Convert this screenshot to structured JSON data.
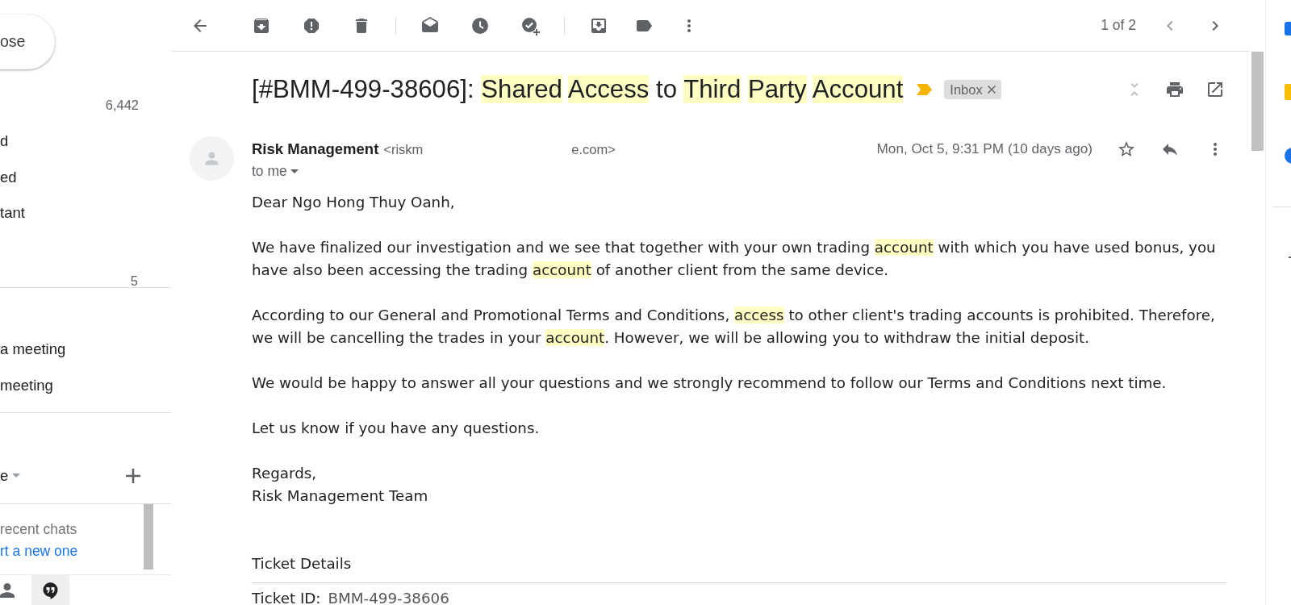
{
  "sidebar": {
    "compose_button": "ose",
    "inbox_count": "6,442",
    "folders": [
      {
        "label": "d"
      },
      {
        "label": "ed"
      },
      {
        "label": "tant"
      }
    ],
    "more_count": "5",
    "meet_items": [
      {
        "label": "a meeting"
      },
      {
        "label": "meeting"
      }
    ],
    "hangouts": {
      "status_label": "e",
      "empty_text": "recent chats",
      "start_link": "rt a new one"
    },
    "bottom_tabs": [
      {
        "kind": "contacts",
        "selected": false
      },
      {
        "kind": "chat",
        "selected": true
      }
    ]
  },
  "toolbar": {
    "pagination": "1 of 2"
  },
  "message": {
    "subject_words": [
      {
        "text": "[#BMM-499-38606]:",
        "highlight": false
      },
      {
        "text": "Shared",
        "highlight": true
      },
      {
        "text": "Access",
        "highlight": true
      },
      {
        "text": "to",
        "highlight": false
      },
      {
        "text": "Third",
        "highlight": true
      },
      {
        "text": "Party",
        "highlight": true
      },
      {
        "text": "Account",
        "highlight": true
      }
    ],
    "important": true,
    "labels": [
      {
        "text": "Inbox"
      }
    ],
    "sender_name": "Risk Management",
    "sender_email_start": "<riskm",
    "sender_email_end": "e.com>",
    "recipient": "to me",
    "date": "Mon, Oct 5, 9:31 PM (10 days ago)",
    "starred": false,
    "body": [
      {
        "kind": "paragraph",
        "segments": [
          {
            "text": "Dear Ngo Hong Thuy Oanh,",
            "highlight": false
          }
        ]
      },
      {
        "kind": "paragraph",
        "segments": [
          {
            "text": "We have finalized our investigation and we see that together with your own trading ",
            "highlight": false
          },
          {
            "text": "account",
            "highlight": true
          },
          {
            "text": " with which you have used bonus, you have also been accessing the trading ",
            "highlight": false
          },
          {
            "text": "account",
            "highlight": true
          },
          {
            "text": " of another client from the same device.",
            "highlight": false
          }
        ]
      },
      {
        "kind": "paragraph",
        "segments": [
          {
            "text": "According to our General and Promotional Terms and Conditions, ",
            "highlight": false
          },
          {
            "text": "access",
            "highlight": true
          },
          {
            "text": " to other client's trading accounts is prohibited. Therefore, we will be cancelling the trades in your ",
            "highlight": false
          },
          {
            "text": "account",
            "highlight": true
          },
          {
            "text": ". However, we will be allowing you to withdraw the initial deposit.",
            "highlight": false
          }
        ]
      },
      {
        "kind": "paragraph",
        "segments": [
          {
            "text": "We would be happy to answer all your questions and we strongly recommend to follow our Terms and Conditions next time.",
            "highlight": false
          }
        ]
      },
      {
        "kind": "paragraph",
        "segments": [
          {
            "text": "Let us know if you have any questions.",
            "highlight": false
          }
        ]
      },
      {
        "kind": "signature",
        "lines": [
          "Regards,",
          "Risk Management Team"
        ]
      },
      {
        "kind": "heading",
        "text": "Ticket Details"
      },
      {
        "kind": "field",
        "label": "Ticket ID:",
        "value": "BMM-499-38606"
      }
    ]
  }
}
